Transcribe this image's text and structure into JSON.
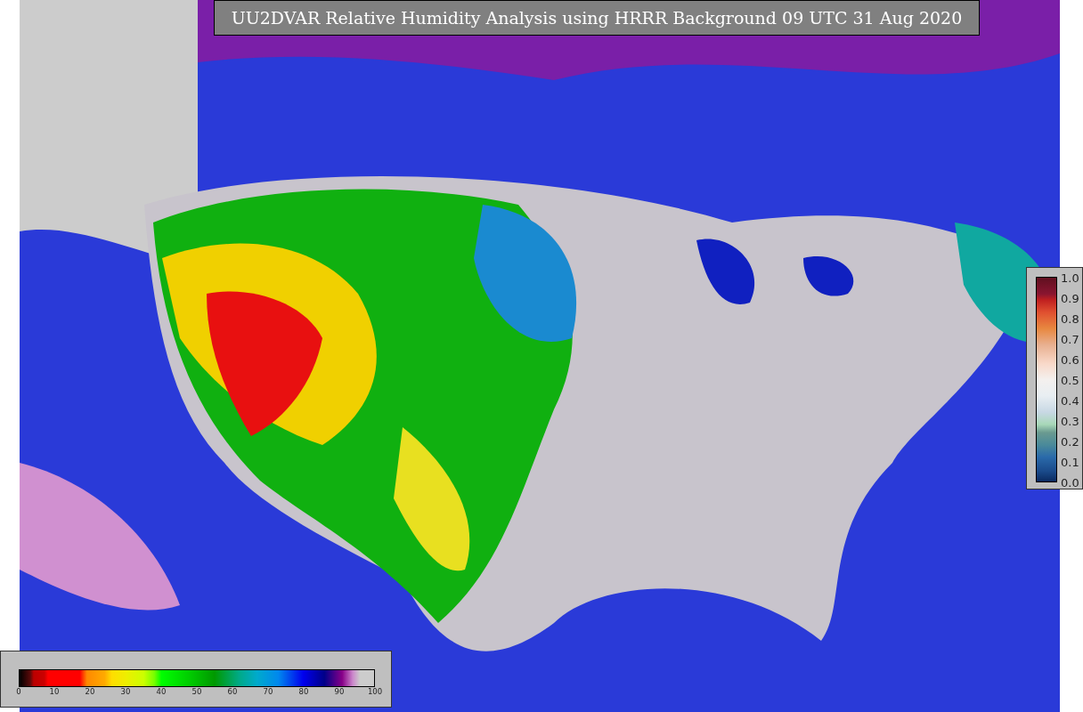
{
  "title": "UU2DVAR Relative Humidity Analysis using HRRR Background 09 UTC 31 Aug 2020",
  "humidity_scale": {
    "ticks": [
      "0",
      "10",
      "20",
      "30",
      "40",
      "50",
      "60",
      "70",
      "80",
      "90",
      "100"
    ]
  },
  "probability_scale": {
    "ticks": [
      "1.0",
      "0.9",
      "0.8",
      "0.7",
      "0.6",
      "0.5",
      "0.4",
      "0.3",
      "0.2",
      "0.1",
      "0.0"
    ]
  }
}
